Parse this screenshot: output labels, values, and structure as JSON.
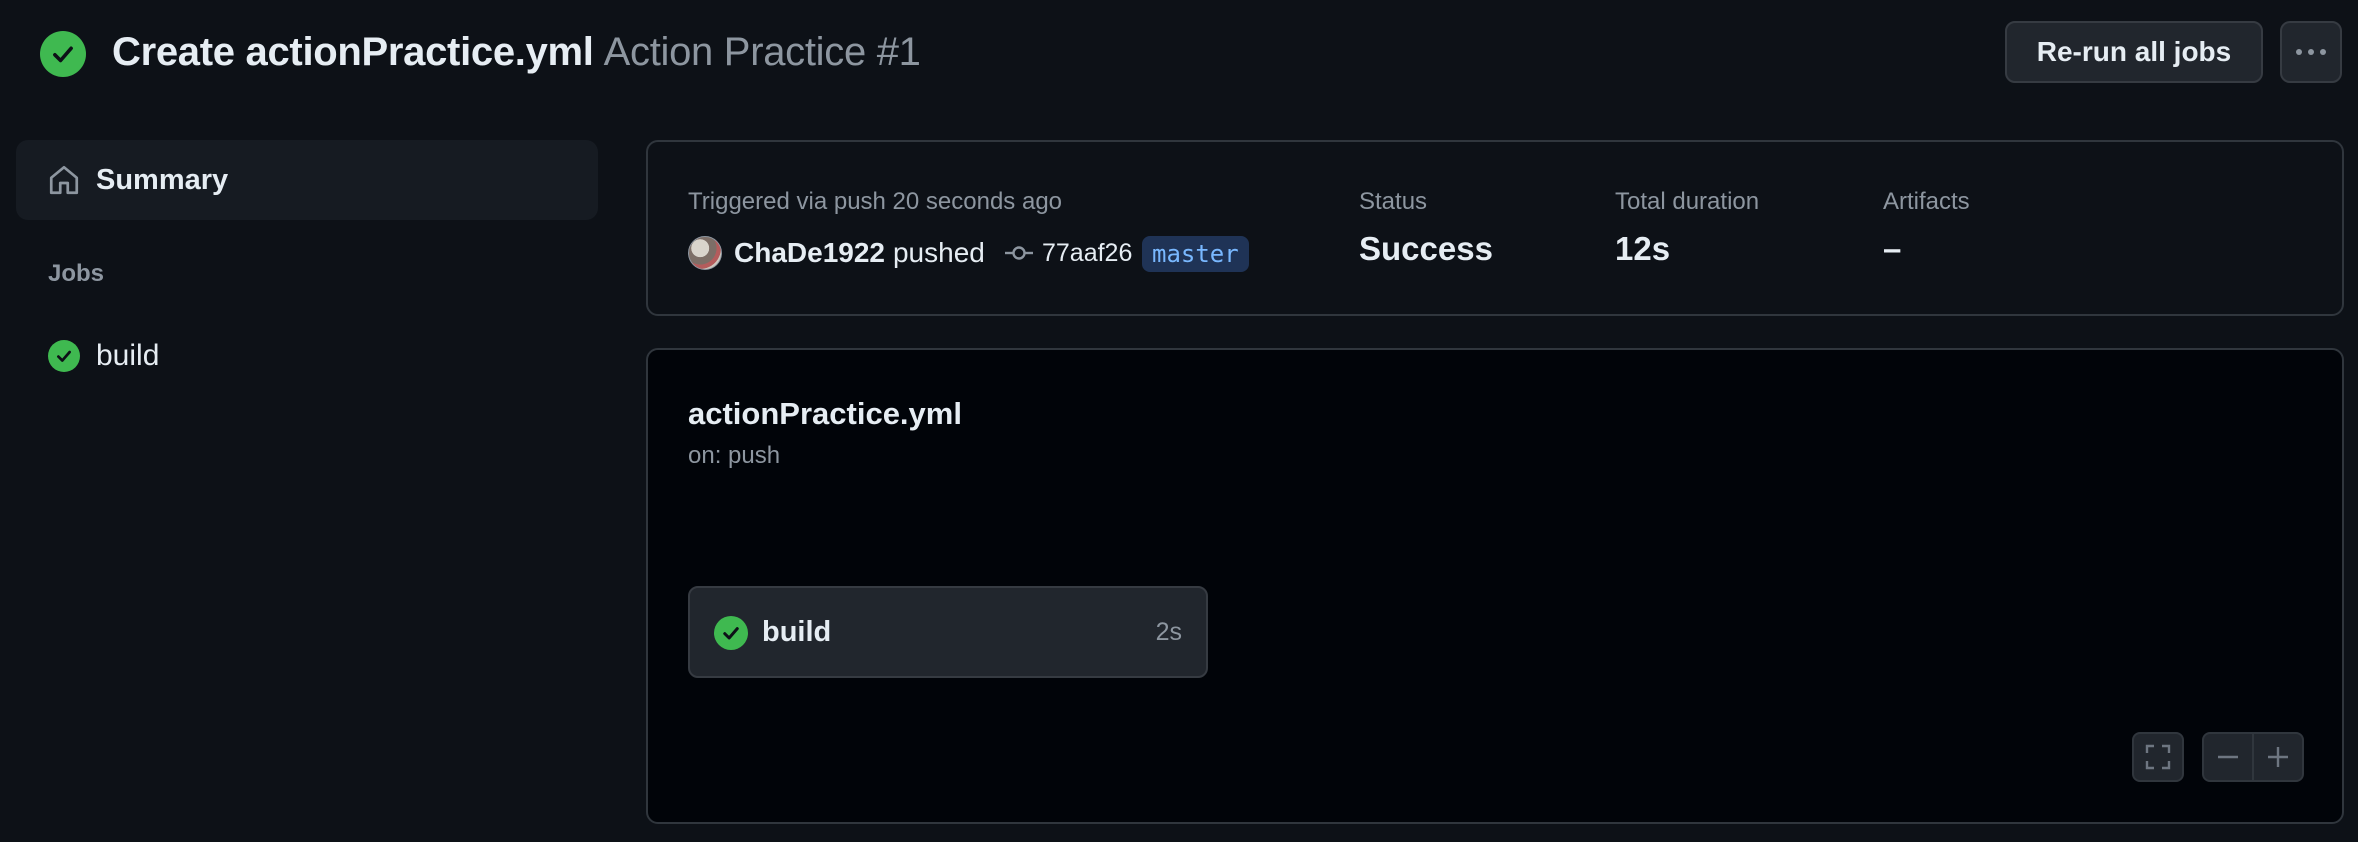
{
  "header": {
    "title": "Create actionPractice.yml",
    "subtitle": "Action Practice #1",
    "rerun_label": "Re-run all jobs",
    "status_icon": "check-circle-fill",
    "more_icon": "kebab-horizontal"
  },
  "sidebar": {
    "summary_label": "Summary",
    "summary_icon": "home",
    "jobs_heading": "Jobs",
    "jobs": [
      {
        "label": "build",
        "status": "success"
      }
    ]
  },
  "summary": {
    "trigger_text": "Triggered via push 20 seconds ago",
    "user": "ChaDe1922",
    "action": "pushed",
    "commit_sha": "77aaf26",
    "branch": "master",
    "status_label": "Status",
    "status_value": "Success",
    "duration_label": "Total duration",
    "duration_value": "12s",
    "artifacts_label": "Artifacts",
    "artifacts_value": "–"
  },
  "workflow": {
    "file_name": "actionPractice.yml",
    "trigger": "on: push",
    "jobs": [
      {
        "name": "build",
        "duration": "2s",
        "status": "success"
      }
    ]
  },
  "colors": {
    "background": "#0d1117",
    "success": "#3fb950",
    "branch_bg": "#1f3356",
    "branch_fg": "#79b8ff",
    "muted_text": "#8d96a0"
  }
}
